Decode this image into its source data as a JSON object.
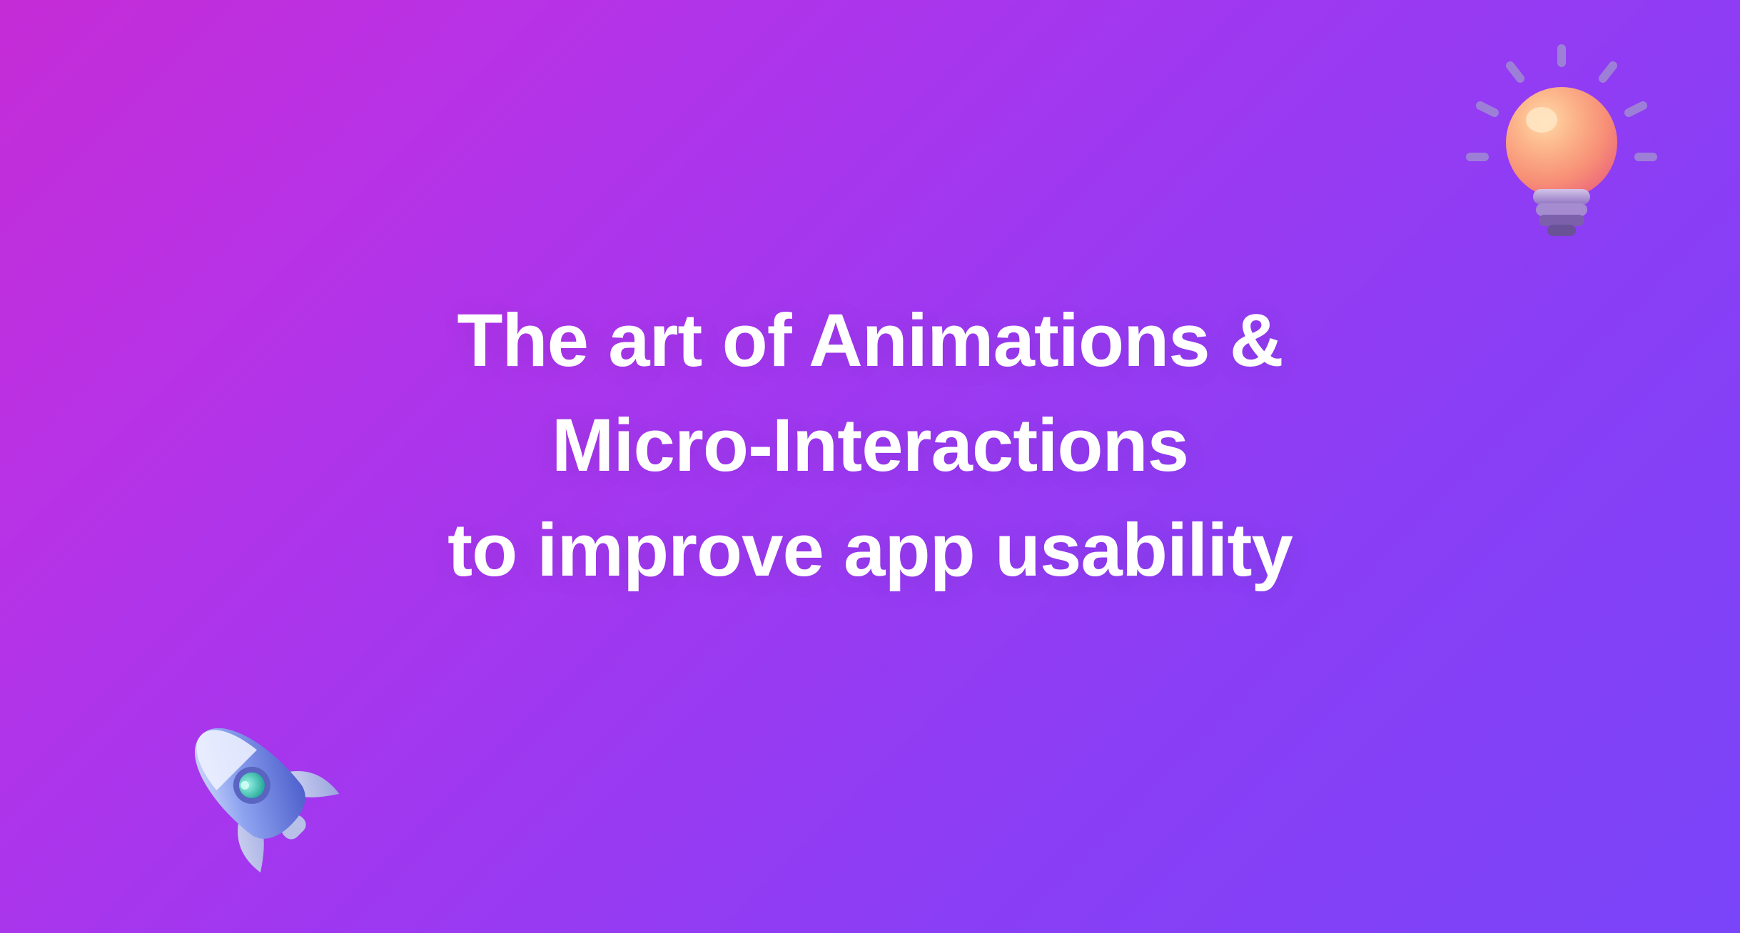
{
  "hero": {
    "line1": "The art of Animations &",
    "line2": "Micro-Interactions",
    "line3": "to improve app usability"
  },
  "icons": {
    "lightbulb_name": "lightbulb-icon",
    "rocket_name": "rocket-icon"
  }
}
